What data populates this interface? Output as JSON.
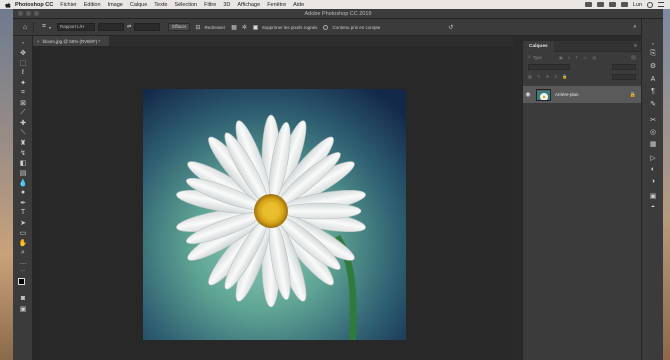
{
  "menubar": {
    "app": "Photoshop CC",
    "items": [
      "Fichier",
      "Edition",
      "Image",
      "Calque",
      "Texte",
      "Sélection",
      "Filtre",
      "3D",
      "Affichage",
      "Fenêtre",
      "Aide"
    ],
    "clock": "Lun"
  },
  "window": {
    "title": "Adobe Photoshop CC 2019"
  },
  "options_bar": {
    "ratio_select": "Rapport L/H",
    "clear_button": "Effacer",
    "straighten_label": "Redresser",
    "delete_cropped_label": "Supprimer les pixels rognés",
    "content_aware_label": "Contenu pris en compte"
  },
  "document": {
    "tab_label": "bloom.jpg @ 50% (RVB/8*) *"
  },
  "layers_panel": {
    "tab_label": "Calques",
    "kind_placeholder": "Type",
    "layer_name": "Arrière-plan"
  },
  "colors": {
    "chrome": "#3b3b3b",
    "canvas_bg": "#282828",
    "selected_layer": "#5a5a5a"
  }
}
